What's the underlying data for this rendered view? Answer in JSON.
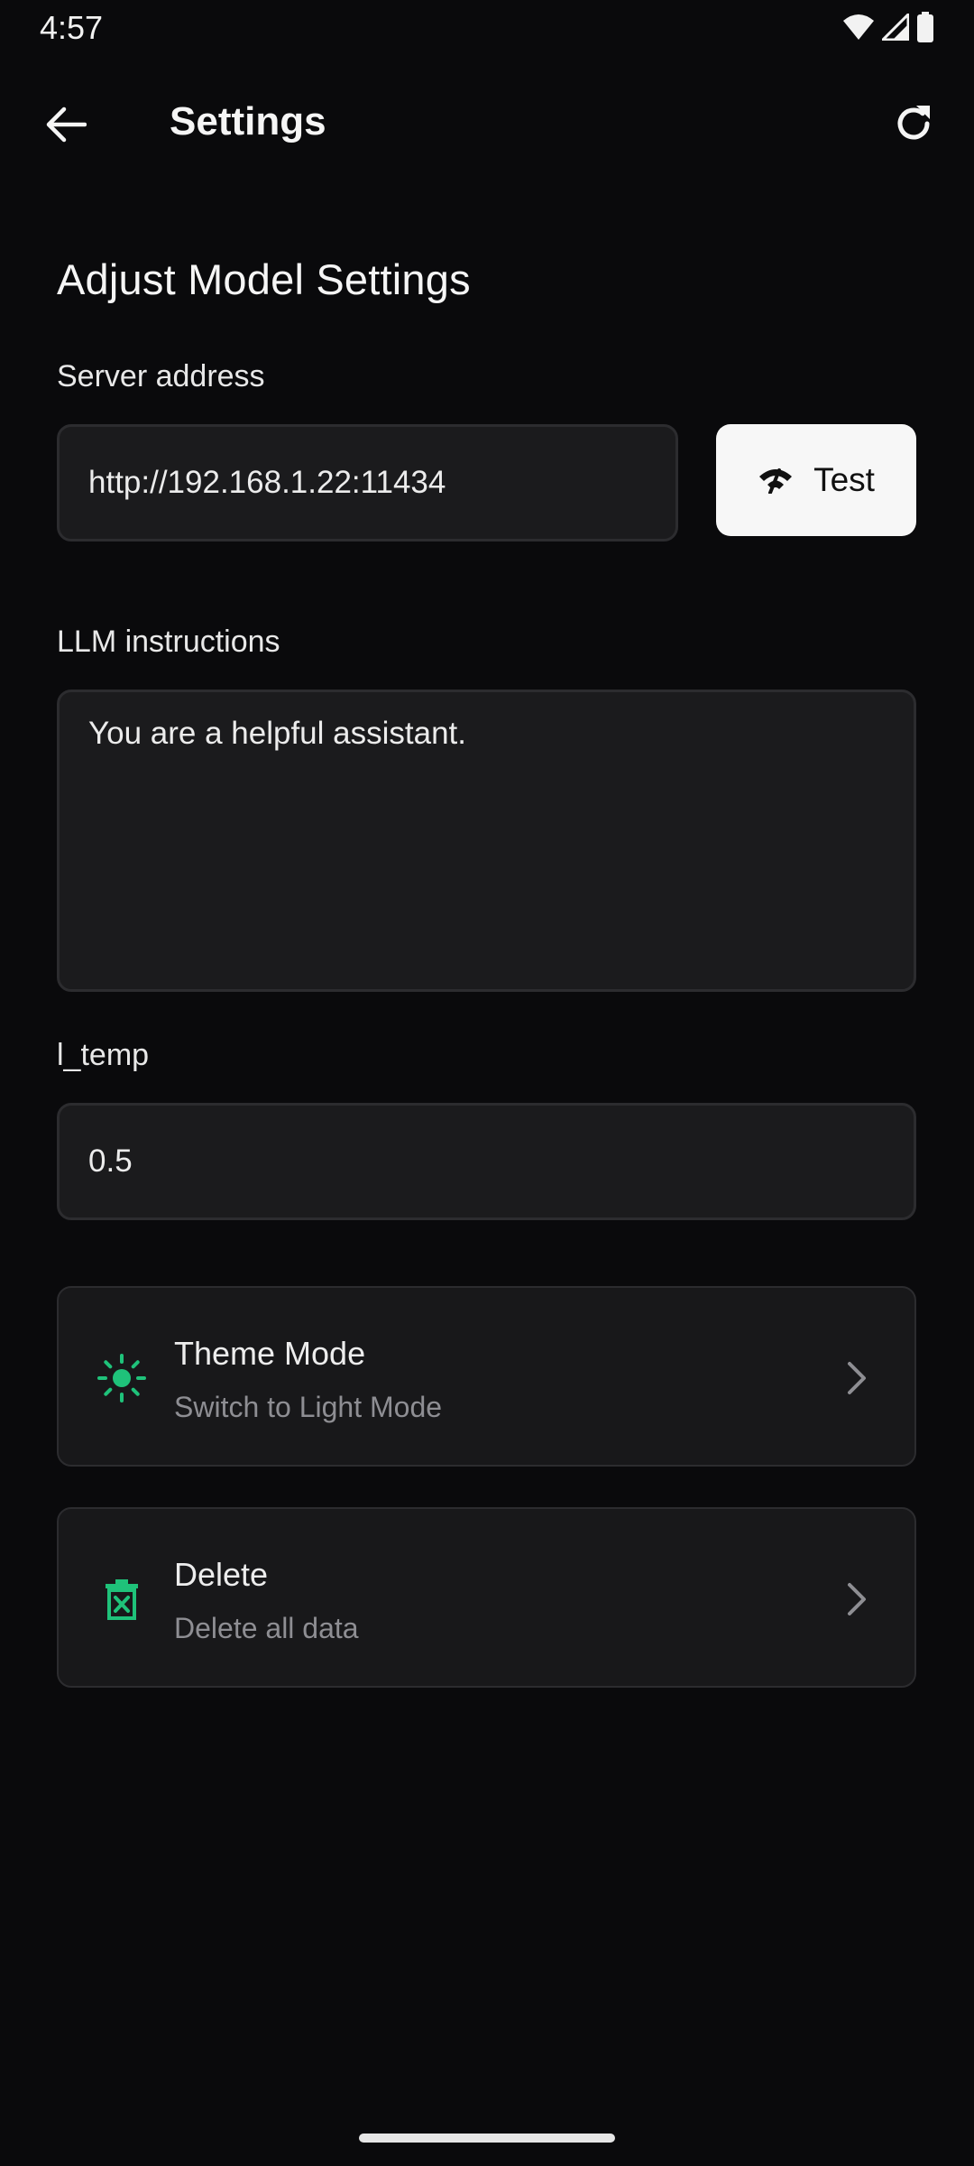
{
  "status_bar": {
    "time": "4:57",
    "icons": [
      "wifi-icon",
      "cell-signal-icon",
      "battery-icon"
    ]
  },
  "app_bar": {
    "title": "Settings",
    "back_icon": "arrow-left-icon",
    "refresh_icon": "refresh-icon"
  },
  "section": {
    "title": "Adjust Model Settings"
  },
  "server": {
    "label": "Server address",
    "value": "http://192.168.1.22:11434",
    "test_button_label": "Test",
    "test_icon": "signal-test-icon"
  },
  "instructions": {
    "label": "LLM instructions",
    "value": "You are a helpful assistant."
  },
  "temperature": {
    "label": "l_temp",
    "value": "0.5"
  },
  "cards": [
    {
      "title": "Theme Mode",
      "subtitle": "Switch to Light Mode",
      "icon": "sun-icon"
    },
    {
      "title": "Delete",
      "subtitle": "Delete all data",
      "icon": "trash-icon"
    }
  ],
  "colors": {
    "background": "#0a0a0c",
    "field_background": "#1b1b1d",
    "accent": "#1fc27a",
    "text_primary": "#f2f2f2",
    "text_secondary": "#8e8e93"
  }
}
